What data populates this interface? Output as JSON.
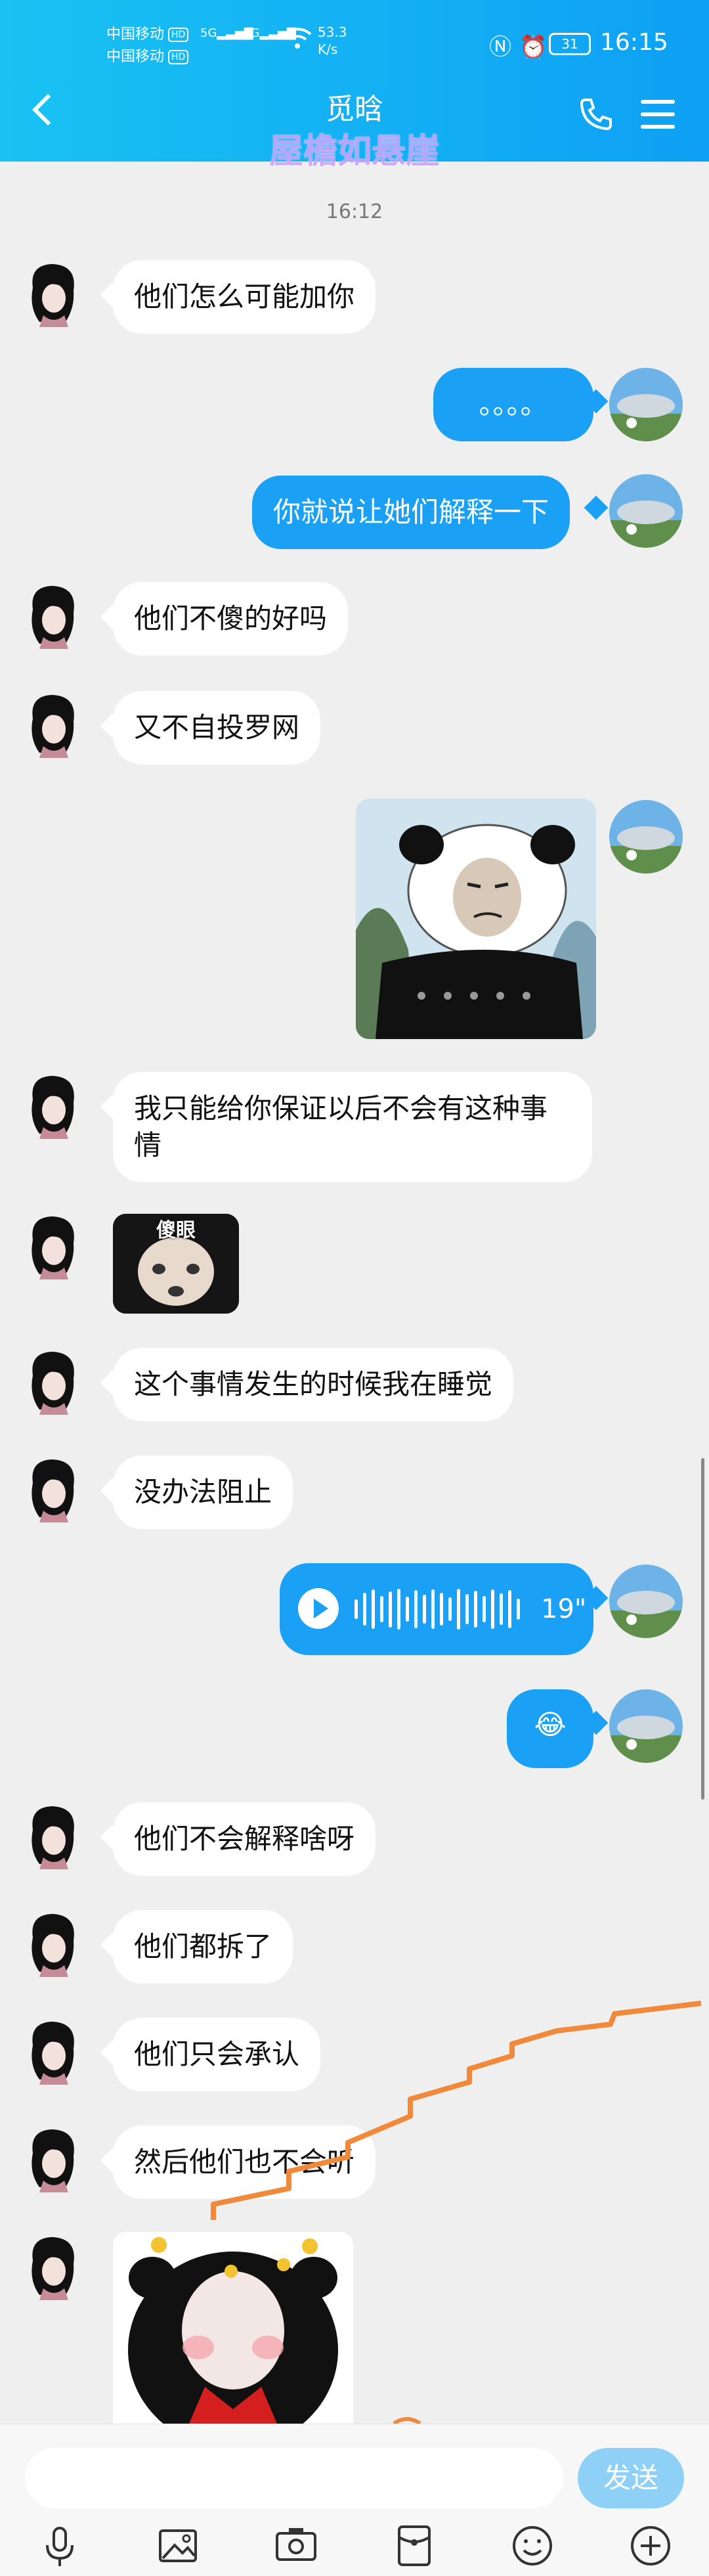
{
  "status_bar": {
    "carrier1": "中国移动",
    "carrier2": "中国移动",
    "hd": "HD",
    "net1": "5G",
    "net2": "4G",
    "speed_value": "53.3",
    "speed_unit": "K/s",
    "battery": "31",
    "time": "16:15"
  },
  "header": {
    "title": "觅晗",
    "subtitle": "屋檐如悬崖"
  },
  "timestamp": "16:12",
  "messages": [
    {
      "side": "left",
      "type": "text",
      "text": "他们怎么可能加你"
    },
    {
      "side": "right",
      "type": "text",
      "text": "。。。。"
    },
    {
      "side": "right",
      "type": "text",
      "text": "你就说让她们解释一下"
    },
    {
      "side": "left",
      "type": "text",
      "text": "他们不傻的好吗"
    },
    {
      "side": "left",
      "type": "text",
      "text": "又不自投罗网"
    },
    {
      "side": "right",
      "type": "sticker",
      "sticker": "panda-meme-sticker"
    },
    {
      "side": "left",
      "type": "text",
      "text": "我只能给你保证以后不会有这种事情"
    },
    {
      "side": "left",
      "type": "sticker",
      "sticker": "stunned-face-sticker",
      "caption": "傻眼"
    },
    {
      "side": "left",
      "type": "text",
      "text": "这个事情发生的时候我在睡觉"
    },
    {
      "side": "left",
      "type": "text",
      "text": "没办法阻止"
    },
    {
      "side": "right",
      "type": "voice",
      "duration": "19\""
    },
    {
      "side": "right",
      "type": "emoji",
      "text": "😂"
    },
    {
      "side": "left",
      "type": "text",
      "text": "他们不会解释啥呀"
    },
    {
      "side": "left",
      "type": "text",
      "text": "他们都拆了"
    },
    {
      "side": "left",
      "type": "text",
      "text": "他们只会承认"
    },
    {
      "side": "left",
      "type": "text",
      "text": "然后他们也不会听"
    },
    {
      "side": "left",
      "type": "sticker",
      "sticker": "bee-panda-sticker"
    }
  ],
  "composer": {
    "placeholder": "",
    "send_label": "发送"
  },
  "toolbar": [
    "microphone-icon",
    "image-icon",
    "camera-icon",
    "red-packet-icon",
    "emoji-icon",
    "plus-icon"
  ],
  "colors": {
    "accent": "#1aa0f5",
    "header_start": "#19c2f3",
    "bubble_left": "#ffffff",
    "background": "#efefef",
    "annotation": "#f08a3a"
  }
}
